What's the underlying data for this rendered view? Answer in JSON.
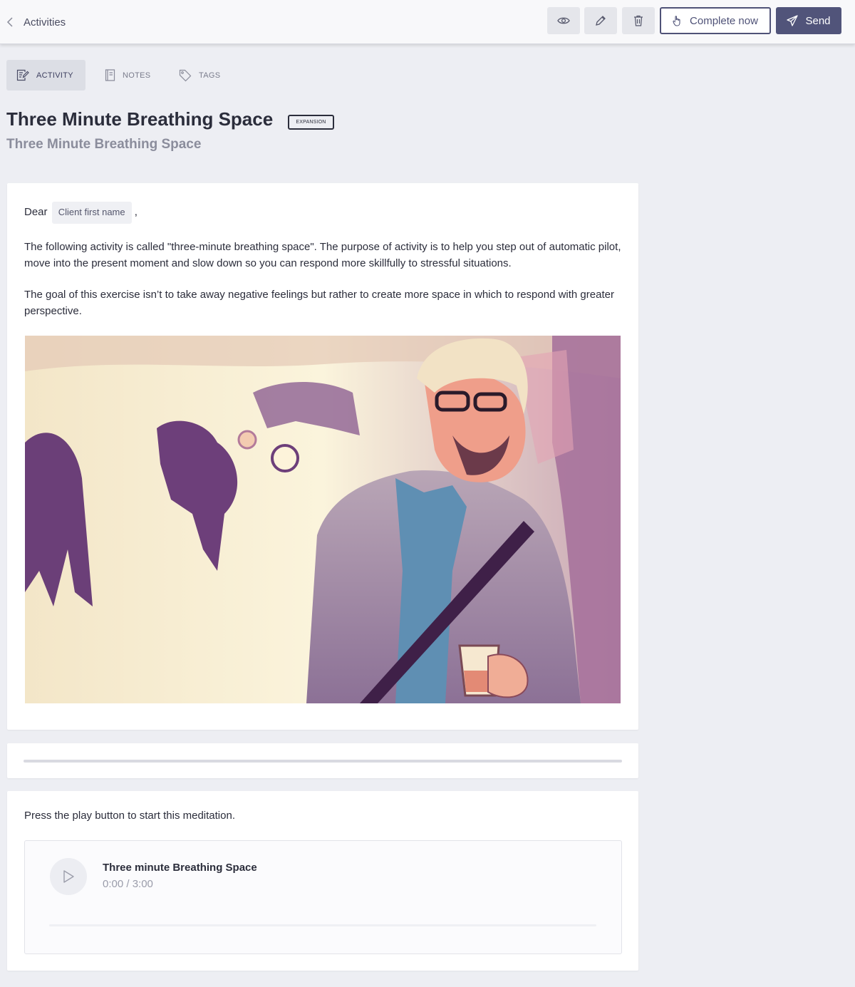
{
  "topbar": {
    "back_label": "Activities",
    "complete_label": "Complete now",
    "send_label": "Send",
    "icons": [
      "chevron-left-icon",
      "eye-icon",
      "pencil-icon",
      "trash-icon",
      "hand-pointer-icon",
      "paper-plane-icon"
    ]
  },
  "tabs": [
    {
      "label": "ACTIVITY",
      "icon": "document-edit-icon",
      "active": true
    },
    {
      "label": "NOTES",
      "icon": "notebook-icon",
      "active": false
    },
    {
      "label": "TAGS",
      "icon": "tag-icon",
      "active": false
    }
  ],
  "activity": {
    "title": "Three Minute Breathing Space",
    "badge": "EXPANSION",
    "subtitle": "Three Minute Breathing Space"
  },
  "content": {
    "greeting": "Dear",
    "placeholder_chip": "Client first name",
    "greeting_suffix": ",",
    "paragraph_1": "The following activity is called \"three-minute breathing space\". The purpose of activity is to help you step out of automatic pilot, move into the present moment and slow down so you can respond more skillfully to stressful situations.",
    "paragraph_2": "The goal of this exercise isn’t to take away negative feelings but rather to create more space in which to respond with greater perspective."
  },
  "meditation": {
    "instruction": "Press the play button to start this meditation.",
    "track_title": "Three minute Breathing Space",
    "time": "0:00 / 3:00",
    "progress": 0
  },
  "colors": {
    "accent": "#51547a",
    "background": "#edeef3",
    "card": "#ffffff"
  }
}
